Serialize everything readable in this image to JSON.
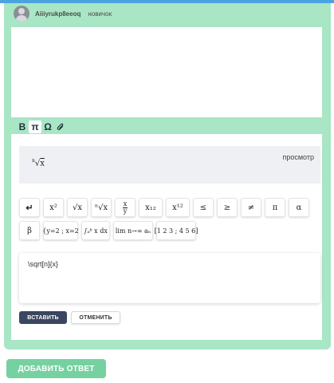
{
  "user": {
    "name": "Aiiiyrukp8eeoq",
    "rank": "новичок"
  },
  "toolbar": {
    "bold": "B",
    "math": "π",
    "omega": "Ω"
  },
  "preview": {
    "label": "просмотр",
    "math_root_index": "n",
    "math_radicand": "x"
  },
  "math_buttons_row1": [
    {
      "name": "newline-button",
      "text": "↵"
    },
    {
      "name": "square-button",
      "text": "x²"
    },
    {
      "name": "sqrt-button",
      "text": "√x"
    },
    {
      "name": "nth-root-button",
      "text": "ⁿ√x"
    },
    {
      "name": "fraction-button",
      "text": "x/y"
    },
    {
      "name": "subscript-button",
      "text": "x₁₂"
    },
    {
      "name": "superscript-button",
      "text": "x¹²"
    },
    {
      "name": "leq-button",
      "text": "≤"
    },
    {
      "name": "geq-button",
      "text": "≥"
    },
    {
      "name": "neq-button",
      "text": "≠"
    },
    {
      "name": "pi-button",
      "text": "π"
    },
    {
      "name": "alpha-button",
      "text": "α"
    }
  ],
  "math_buttons_row2": [
    {
      "name": "beta-button",
      "text": "β"
    },
    {
      "name": "system-button",
      "text": "{y=2 ; x=2"
    },
    {
      "name": "integral-button",
      "text": "∫ₐᵇ x dx"
    },
    {
      "name": "limit-button",
      "text": "lim n→∞ aₙ"
    },
    {
      "name": "matrix-button",
      "text": "[1 2 3 ; 4 5 6]"
    }
  ],
  "input": {
    "value": "\\sqrt[n]{x}"
  },
  "actions": {
    "insert": "ВСТАВИТЬ",
    "cancel": "ОТМЕНИТЬ"
  },
  "add_answer": "ДОБАВИТЬ ОТВЕТ",
  "colors": {
    "panel": "#a8e6c5",
    "accent": "#76d1a1",
    "insert_button": "#3b4660",
    "top_line": "#4aa3df"
  }
}
